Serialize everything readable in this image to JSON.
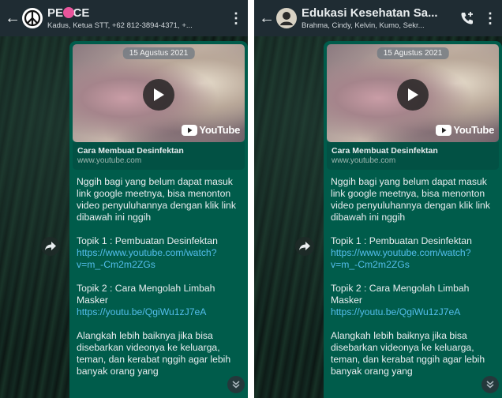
{
  "left": {
    "header": {
      "back_icon": "arrow-left-icon",
      "avatar_icon": "peace-symbol-icon",
      "title": "PE   CE",
      "title_emoji_icon": "cat-emoji-icon",
      "subtitle": "Kadus, Ketua STT, +62 812-3894-4371, +...",
      "menu_icon": "more-vertical-icon"
    },
    "message": {
      "date_chip": "15 Agustus 2021",
      "link_title": "Cara Membuat Desinfektan",
      "link_domain": "www.youtube.com",
      "youtube_label": "YouTube",
      "para1": "Nggih bagi yang belum dapat masuk link google meetnya, bisa menonton video penyuluhannya dengan klik link dibawah ini nggih",
      "topic1": "Topik 1 : Pembuatan Desinfektan",
      "topic1_link": "https://www.youtube.com/watch?v=m_-Cm2m2ZGs",
      "topic2": "Topik 2 : Cara Mengolah Limbah Masker",
      "topic2_link": "https://youtu.be/QgiWu1zJ7eA",
      "para_last": "Alangkah lebih baiknya jika bisa disebarkan videonya ke keluarga, teman, dan kerabat nggih agar lebih banyak orang yang"
    }
  },
  "right": {
    "header": {
      "back_icon": "arrow-left-icon",
      "avatar_icon": "group-avatar-icon",
      "title": "Edukasi Kesehatan Sa...",
      "subtitle": "Brahma, Cindy, Kelvin, Kumo, Sekr...",
      "call_icon": "add-call-icon",
      "menu_icon": "more-vertical-icon"
    },
    "message": {
      "date_chip": "15 Agustus 2021",
      "link_title": "Cara Membuat Desinfektan",
      "link_domain": "www.youtube.com",
      "youtube_label": "YouTube",
      "para1": "Nggih bagi yang belum dapat masuk link google meetnya, bisa menonton video penyuluhannya dengan klik link dibawah ini nggih",
      "topic1": "Topik 1 : Pembuatan Desinfektan",
      "topic1_link": "https://www.youtube.com/watch?v=m_-Cm2m2ZGs",
      "topic2": "Topik 2 : Cara Mengolah Limbah Masker",
      "topic2_link": "https://youtu.be/QgiWu1zJ7eA",
      "para_last": "Alangkah lebih baiknya jika bisa disebarkan videonya ke keluarga, teman, dan kerabat nggih agar lebih banyak orang yang"
    }
  },
  "colors": {
    "header_bg": "#1f2c33",
    "bubble_bg": "#005c4b",
    "link_color": "#53bdeb",
    "youtube_red": "#ff0000"
  }
}
